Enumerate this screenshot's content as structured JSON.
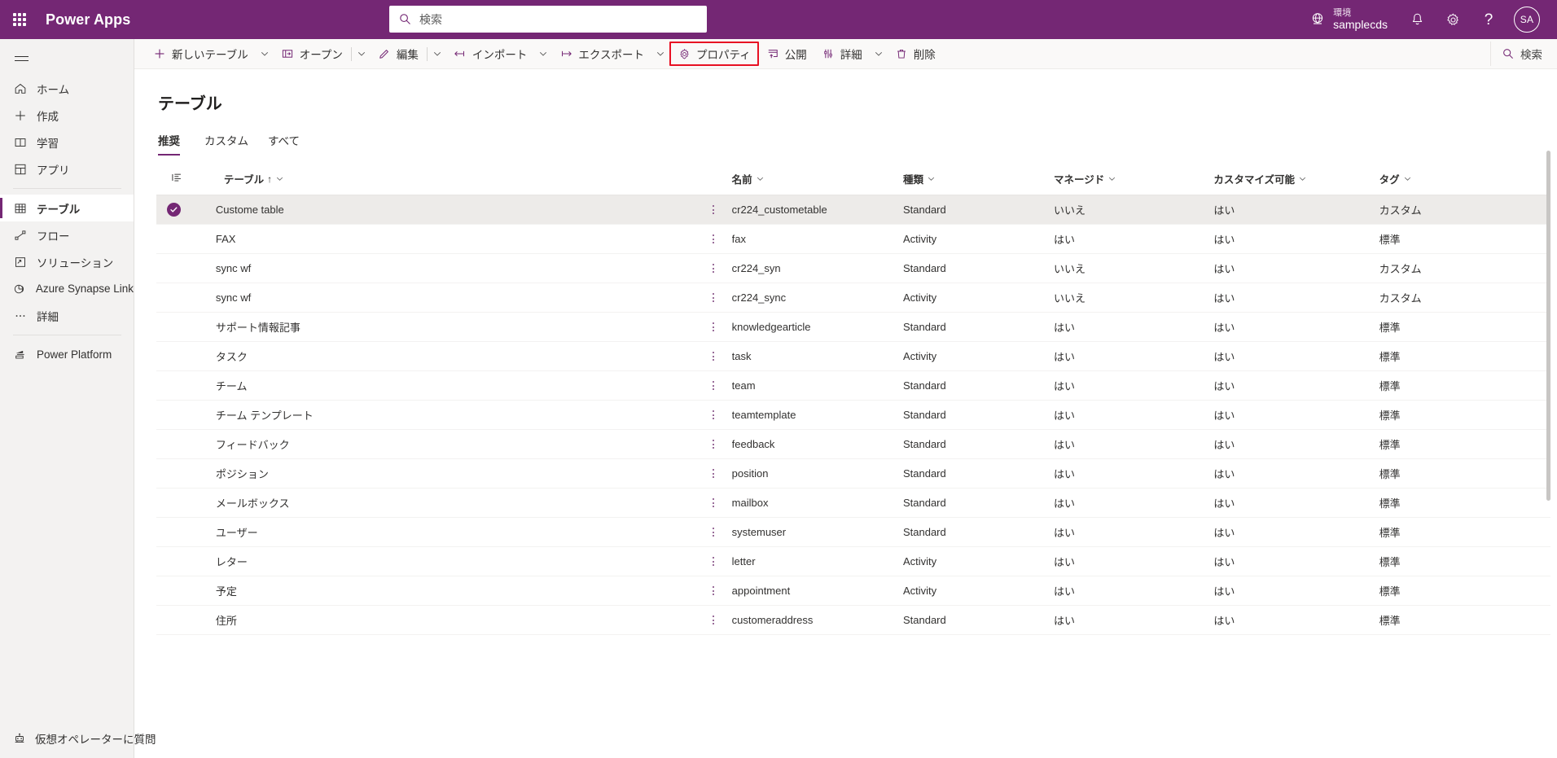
{
  "header": {
    "brand": "Power Apps",
    "waffle_icon": "app-launcher-icon",
    "search_placeholder": "検索",
    "search_icon": "search-icon",
    "environment": {
      "icon": "environment-globe-icon",
      "label": "環境",
      "name": "samplecds"
    },
    "notifications_icon": "bell-icon",
    "settings_icon": "gear-icon",
    "help_icon": "question-mark-icon",
    "avatar_initials": "SA",
    "brand_color": "#742774"
  },
  "sidebar": {
    "hamburger_icon": "hamburger-menu-icon",
    "items": [
      {
        "label": "ホーム",
        "icon": "home-icon",
        "selected": false
      },
      {
        "label": "作成",
        "icon": "plus-icon",
        "selected": false
      },
      {
        "label": "学習",
        "icon": "book-icon",
        "selected": false
      },
      {
        "label": "アプリ",
        "icon": "apps-grid-icon",
        "selected": false
      },
      {
        "label": "テーブル",
        "icon": "table-icon",
        "selected": true
      },
      {
        "label": "フロー",
        "icon": "flow-icon",
        "selected": false
      },
      {
        "label": "ソリューション",
        "icon": "solution-icon",
        "selected": false
      },
      {
        "label": "Azure Synapse Link",
        "icon": "synapse-icon",
        "selected": false
      },
      {
        "label": "詳細",
        "icon": "ellipsis-icon",
        "selected": false
      }
    ],
    "platform_item": {
      "label": "Power Platform",
      "icon": "power-platform-icon"
    },
    "bottom_item": {
      "label": "仮想オペレーターに質問",
      "icon": "virtual-agent-robot-icon"
    }
  },
  "commandbar": {
    "items": [
      {
        "label": "新しいテーブル",
        "icon": "plus-icon",
        "has_chevron": true,
        "highlighted": false
      },
      {
        "label": "オープン",
        "icon": "open-table-icon",
        "has_chevron": true,
        "separator_before_chevron": true,
        "highlighted": false
      },
      {
        "label": "編集",
        "icon": "pencil-icon",
        "has_chevron": true,
        "separator_before_chevron": true,
        "highlighted": false
      },
      {
        "label": "インポート",
        "icon": "import-arrow-icon",
        "has_chevron": true,
        "highlighted": false
      },
      {
        "label": "エクスポート",
        "icon": "export-arrow-icon",
        "has_chevron": true,
        "highlighted": false
      },
      {
        "label": "プロパティ",
        "icon": "gear-icon",
        "has_chevron": false,
        "highlighted": true
      },
      {
        "label": "公開",
        "icon": "publish-icon",
        "has_chevron": false,
        "highlighted": false
      },
      {
        "label": "詳細",
        "icon": "details-icon",
        "has_chevron": true,
        "highlighted": false
      },
      {
        "label": "削除",
        "icon": "trash-icon",
        "has_chevron": false,
        "highlighted": false
      }
    ],
    "search_placeholder": "検索",
    "search_icon": "search-icon",
    "highlight_color": "#e81123"
  },
  "main": {
    "title": "テーブル",
    "tabs": [
      {
        "label": "推奨",
        "active": true
      },
      {
        "label": "カスタム",
        "active": false
      },
      {
        "label": "すべて",
        "active": false
      }
    ]
  },
  "table": {
    "row_options_icon": "more-options-vertical-icon",
    "column_picker_icon": "column-options-icon",
    "sort_indicator": "↑",
    "columns": [
      {
        "key": "display_name",
        "label": "テーブル",
        "sorted": "asc"
      },
      {
        "key": "logical_name",
        "label": "名前",
        "sorted": ""
      },
      {
        "key": "type",
        "label": "種類",
        "sorted": ""
      },
      {
        "key": "managed",
        "label": "マネージド",
        "sorted": ""
      },
      {
        "key": "customizable",
        "label": "カスタマイズ可能",
        "sorted": ""
      },
      {
        "key": "tag",
        "label": "タグ",
        "sorted": ""
      }
    ],
    "rows": [
      {
        "display_name": "Custome table",
        "logical_name": "cr224_custometable",
        "type": "Standard",
        "managed": "いいえ",
        "customizable": "はい",
        "tag": "カスタム",
        "selected": true
      },
      {
        "display_name": "FAX",
        "logical_name": "fax",
        "type": "Activity",
        "managed": "はい",
        "customizable": "はい",
        "tag": "標準",
        "selected": false
      },
      {
        "display_name": "sync wf",
        "logical_name": "cr224_syn",
        "type": "Standard",
        "managed": "いいえ",
        "customizable": "はい",
        "tag": "カスタム",
        "selected": false
      },
      {
        "display_name": "sync wf",
        "logical_name": "cr224_sync",
        "type": "Activity",
        "managed": "いいえ",
        "customizable": "はい",
        "tag": "カスタム",
        "selected": false
      },
      {
        "display_name": "サポート情報記事",
        "logical_name": "knowledgearticle",
        "type": "Standard",
        "managed": "はい",
        "customizable": "はい",
        "tag": "標準",
        "selected": false
      },
      {
        "display_name": "タスク",
        "logical_name": "task",
        "type": "Activity",
        "managed": "はい",
        "customizable": "はい",
        "tag": "標準",
        "selected": false
      },
      {
        "display_name": "チーム",
        "logical_name": "team",
        "type": "Standard",
        "managed": "はい",
        "customizable": "はい",
        "tag": "標準",
        "selected": false
      },
      {
        "display_name": "チーム テンプレート",
        "logical_name": "teamtemplate",
        "type": "Standard",
        "managed": "はい",
        "customizable": "はい",
        "tag": "標準",
        "selected": false
      },
      {
        "display_name": "フィードバック",
        "logical_name": "feedback",
        "type": "Standard",
        "managed": "はい",
        "customizable": "はい",
        "tag": "標準",
        "selected": false
      },
      {
        "display_name": "ポジション",
        "logical_name": "position",
        "type": "Standard",
        "managed": "はい",
        "customizable": "はい",
        "tag": "標準",
        "selected": false
      },
      {
        "display_name": "メールボックス",
        "logical_name": "mailbox",
        "type": "Standard",
        "managed": "はい",
        "customizable": "はい",
        "tag": "標準",
        "selected": false
      },
      {
        "display_name": "ユーザー",
        "logical_name": "systemuser",
        "type": "Standard",
        "managed": "はい",
        "customizable": "はい",
        "tag": "標準",
        "selected": false
      },
      {
        "display_name": "レター",
        "logical_name": "letter",
        "type": "Activity",
        "managed": "はい",
        "customizable": "はい",
        "tag": "標準",
        "selected": false
      },
      {
        "display_name": "予定",
        "logical_name": "appointment",
        "type": "Activity",
        "managed": "はい",
        "customizable": "はい",
        "tag": "標準",
        "selected": false
      },
      {
        "display_name": "住所",
        "logical_name": "customeraddress",
        "type": "Standard",
        "managed": "はい",
        "customizable": "はい",
        "tag": "標準",
        "selected": false
      }
    ]
  }
}
